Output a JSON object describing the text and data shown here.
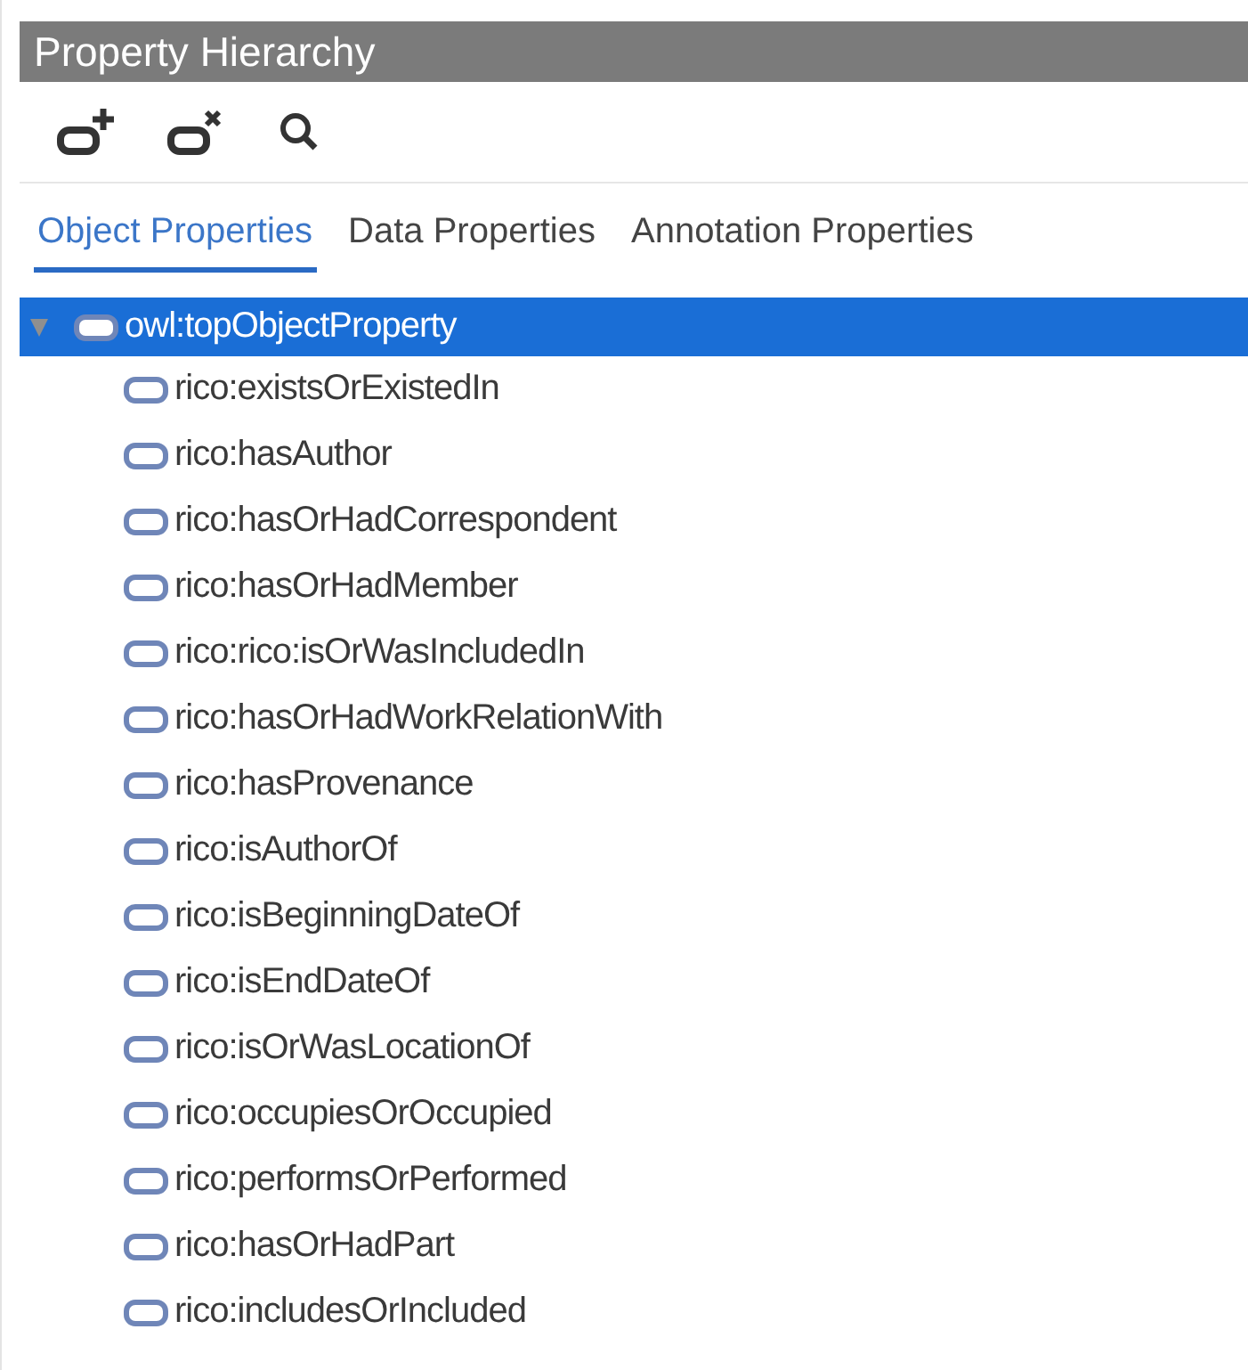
{
  "panel": {
    "title": "Property Hierarchy"
  },
  "toolbar": [
    {
      "kind": "add"
    },
    {
      "kind": "delete"
    },
    {
      "kind": "search"
    }
  ],
  "tabs": [
    {
      "label": "Object Properties",
      "selected": true
    },
    {
      "label": "Data Properties",
      "selected": false
    },
    {
      "label": "Annotation Properties",
      "selected": false
    }
  ],
  "tree": [
    {
      "label": "owl:topObjectProperty",
      "selected": true,
      "expanded": true,
      "children": [
        {
          "label": "rico:existsOrExistedIn",
          "selected": false
        },
        {
          "label": "rico:hasAuthor",
          "selected": false
        },
        {
          "label": "rico:hasOrHadCorrespondent",
          "selected": false
        },
        {
          "label": "rico:hasOrHadMember",
          "selected": false
        },
        {
          "label": "rico:rico:isOrWasIncludedIn",
          "selected": false
        },
        {
          "label": "rico:hasOrHadWorkRelationWith",
          "selected": false
        },
        {
          "label": "rico:hasProvenance",
          "selected": false
        },
        {
          "label": "rico:isAuthorOf",
          "selected": false
        },
        {
          "label": "rico:isBeginningDateOf",
          "selected": false
        },
        {
          "label": "rico:isEndDateOf",
          "selected": false
        },
        {
          "label": "rico:isOrWasLocationOf",
          "selected": false
        },
        {
          "label": "rico:occupiesOrOccupied",
          "selected": false
        },
        {
          "label": "rico:performsOrPerformed",
          "selected": false
        },
        {
          "label": "rico:hasOrHadPart",
          "selected": false
        },
        {
          "label": "rico:includesOrIncluded",
          "selected": false
        }
      ]
    }
  ]
}
